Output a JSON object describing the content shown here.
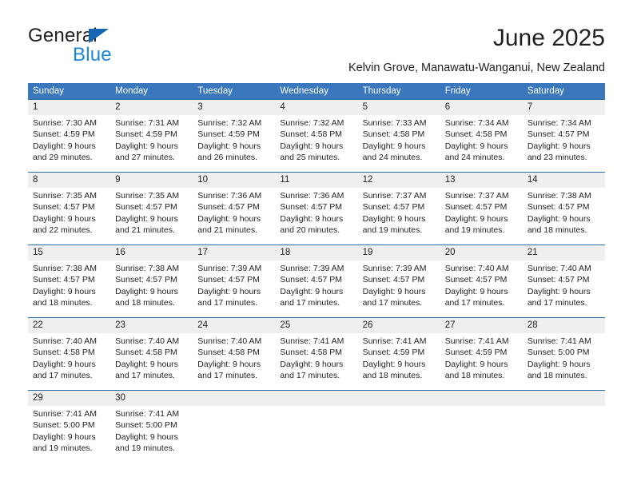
{
  "brand": {
    "name_top": "General",
    "name_bottom": "Blue",
    "triangle_color": "#1567b3",
    "blue_color": "#1c87dc"
  },
  "header": {
    "title": "June 2025",
    "subtitle": "Kelvin Grove, Manawatu-Wanganui, New Zealand"
  },
  "theme": {
    "header_bg": "#3a77bc",
    "header_text": "#ffffff",
    "daynum_bg": "#efefef",
    "rule_color": "#2e6da4",
    "body_text": "#231f20"
  },
  "calendar": {
    "weekdays": [
      "Sunday",
      "Monday",
      "Tuesday",
      "Wednesday",
      "Thursday",
      "Friday",
      "Saturday"
    ],
    "weeks": [
      {
        "numbers": [
          "1",
          "2",
          "3",
          "4",
          "5",
          "6",
          "7"
        ],
        "cells": [
          {
            "l1": "Sunrise: 7:30 AM",
            "l2": "Sunset: 4:59 PM",
            "l3": "Daylight: 9 hours",
            "l4": "and 29 minutes."
          },
          {
            "l1": "Sunrise: 7:31 AM",
            "l2": "Sunset: 4:59 PM",
            "l3": "Daylight: 9 hours",
            "l4": "and 27 minutes."
          },
          {
            "l1": "Sunrise: 7:32 AM",
            "l2": "Sunset: 4:59 PM",
            "l3": "Daylight: 9 hours",
            "l4": "and 26 minutes."
          },
          {
            "l1": "Sunrise: 7:32 AM",
            "l2": "Sunset: 4:58 PM",
            "l3": "Daylight: 9 hours",
            "l4": "and 25 minutes."
          },
          {
            "l1": "Sunrise: 7:33 AM",
            "l2": "Sunset: 4:58 PM",
            "l3": "Daylight: 9 hours",
            "l4": "and 24 minutes."
          },
          {
            "l1": "Sunrise: 7:34 AM",
            "l2": "Sunset: 4:58 PM",
            "l3": "Daylight: 9 hours",
            "l4": "and 24 minutes."
          },
          {
            "l1": "Sunrise: 7:34 AM",
            "l2": "Sunset: 4:57 PM",
            "l3": "Daylight: 9 hours",
            "l4": "and 23 minutes."
          }
        ]
      },
      {
        "numbers": [
          "8",
          "9",
          "10",
          "11",
          "12",
          "13",
          "14"
        ],
        "cells": [
          {
            "l1": "Sunrise: 7:35 AM",
            "l2": "Sunset: 4:57 PM",
            "l3": "Daylight: 9 hours",
            "l4": "and 22 minutes."
          },
          {
            "l1": "Sunrise: 7:35 AM",
            "l2": "Sunset: 4:57 PM",
            "l3": "Daylight: 9 hours",
            "l4": "and 21 minutes."
          },
          {
            "l1": "Sunrise: 7:36 AM",
            "l2": "Sunset: 4:57 PM",
            "l3": "Daylight: 9 hours",
            "l4": "and 21 minutes."
          },
          {
            "l1": "Sunrise: 7:36 AM",
            "l2": "Sunset: 4:57 PM",
            "l3": "Daylight: 9 hours",
            "l4": "and 20 minutes."
          },
          {
            "l1": "Sunrise: 7:37 AM",
            "l2": "Sunset: 4:57 PM",
            "l3": "Daylight: 9 hours",
            "l4": "and 19 minutes."
          },
          {
            "l1": "Sunrise: 7:37 AM",
            "l2": "Sunset: 4:57 PM",
            "l3": "Daylight: 9 hours",
            "l4": "and 19 minutes."
          },
          {
            "l1": "Sunrise: 7:38 AM",
            "l2": "Sunset: 4:57 PM",
            "l3": "Daylight: 9 hours",
            "l4": "and 18 minutes."
          }
        ]
      },
      {
        "numbers": [
          "15",
          "16",
          "17",
          "18",
          "19",
          "20",
          "21"
        ],
        "cells": [
          {
            "l1": "Sunrise: 7:38 AM",
            "l2": "Sunset: 4:57 PM",
            "l3": "Daylight: 9 hours",
            "l4": "and 18 minutes."
          },
          {
            "l1": "Sunrise: 7:38 AM",
            "l2": "Sunset: 4:57 PM",
            "l3": "Daylight: 9 hours",
            "l4": "and 18 minutes."
          },
          {
            "l1": "Sunrise: 7:39 AM",
            "l2": "Sunset: 4:57 PM",
            "l3": "Daylight: 9 hours",
            "l4": "and 17 minutes."
          },
          {
            "l1": "Sunrise: 7:39 AM",
            "l2": "Sunset: 4:57 PM",
            "l3": "Daylight: 9 hours",
            "l4": "and 17 minutes."
          },
          {
            "l1": "Sunrise: 7:39 AM",
            "l2": "Sunset: 4:57 PM",
            "l3": "Daylight: 9 hours",
            "l4": "and 17 minutes."
          },
          {
            "l1": "Sunrise: 7:40 AM",
            "l2": "Sunset: 4:57 PM",
            "l3": "Daylight: 9 hours",
            "l4": "and 17 minutes."
          },
          {
            "l1": "Sunrise: 7:40 AM",
            "l2": "Sunset: 4:57 PM",
            "l3": "Daylight: 9 hours",
            "l4": "and 17 minutes."
          }
        ]
      },
      {
        "numbers": [
          "22",
          "23",
          "24",
          "25",
          "26",
          "27",
          "28"
        ],
        "cells": [
          {
            "l1": "Sunrise: 7:40 AM",
            "l2": "Sunset: 4:58 PM",
            "l3": "Daylight: 9 hours",
            "l4": "and 17 minutes."
          },
          {
            "l1": "Sunrise: 7:40 AM",
            "l2": "Sunset: 4:58 PM",
            "l3": "Daylight: 9 hours",
            "l4": "and 17 minutes."
          },
          {
            "l1": "Sunrise: 7:40 AM",
            "l2": "Sunset: 4:58 PM",
            "l3": "Daylight: 9 hours",
            "l4": "and 17 minutes."
          },
          {
            "l1": "Sunrise: 7:41 AM",
            "l2": "Sunset: 4:58 PM",
            "l3": "Daylight: 9 hours",
            "l4": "and 17 minutes."
          },
          {
            "l1": "Sunrise: 7:41 AM",
            "l2": "Sunset: 4:59 PM",
            "l3": "Daylight: 9 hours",
            "l4": "and 18 minutes."
          },
          {
            "l1": "Sunrise: 7:41 AM",
            "l2": "Sunset: 4:59 PM",
            "l3": "Daylight: 9 hours",
            "l4": "and 18 minutes."
          },
          {
            "l1": "Sunrise: 7:41 AM",
            "l2": "Sunset: 5:00 PM",
            "l3": "Daylight: 9 hours",
            "l4": "and 18 minutes."
          }
        ]
      },
      {
        "numbers": [
          "29",
          "30",
          "",
          "",
          "",
          "",
          ""
        ],
        "cells": [
          {
            "l1": "Sunrise: 7:41 AM",
            "l2": "Sunset: 5:00 PM",
            "l3": "Daylight: 9 hours",
            "l4": "and 19 minutes."
          },
          {
            "l1": "Sunrise: 7:41 AM",
            "l2": "Sunset: 5:00 PM",
            "l3": "Daylight: 9 hours",
            "l4": "and 19 minutes."
          },
          {
            "l1": "",
            "l2": "",
            "l3": "",
            "l4": ""
          },
          {
            "l1": "",
            "l2": "",
            "l3": "",
            "l4": ""
          },
          {
            "l1": "",
            "l2": "",
            "l3": "",
            "l4": ""
          },
          {
            "l1": "",
            "l2": "",
            "l3": "",
            "l4": ""
          },
          {
            "l1": "",
            "l2": "",
            "l3": "",
            "l4": ""
          }
        ]
      }
    ]
  }
}
